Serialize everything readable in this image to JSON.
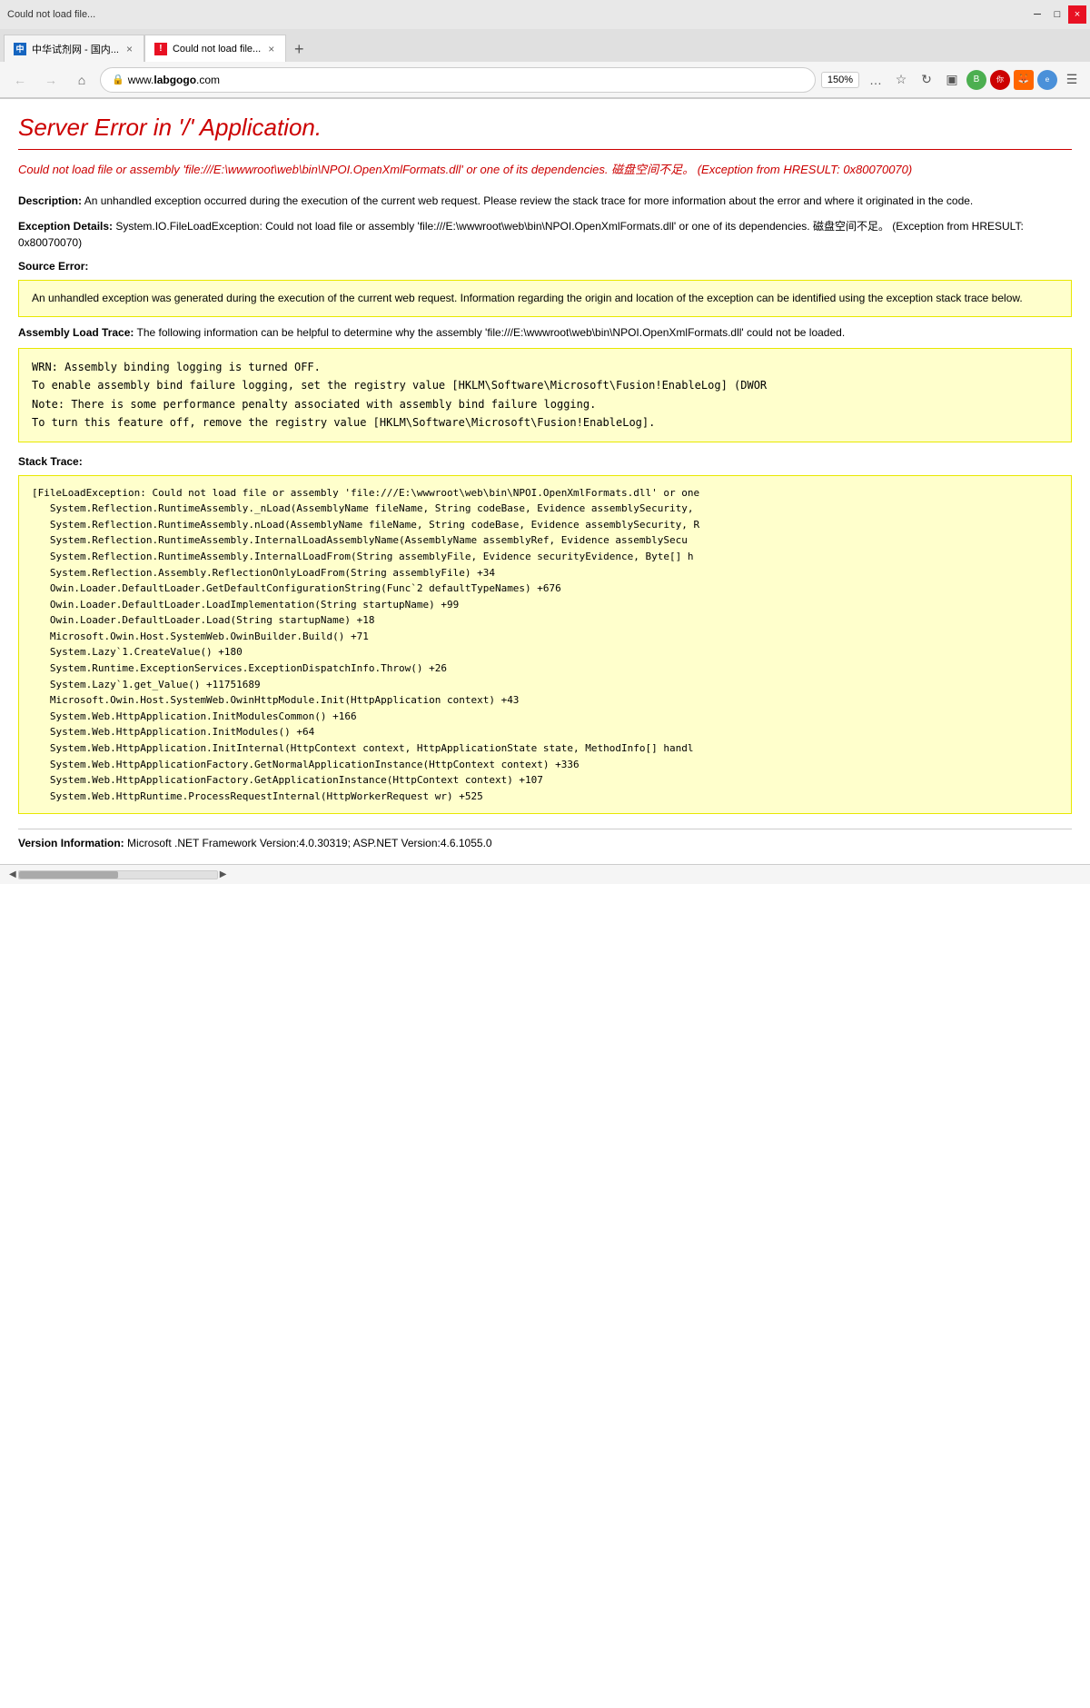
{
  "browser": {
    "tabs": [
      {
        "id": "tab1",
        "favicon_text": "中",
        "label": "中华试剂网 - 国内...",
        "active": false,
        "close_label": "×"
      },
      {
        "id": "tab2",
        "favicon_text": "!",
        "label": "Could not load file...",
        "active": true,
        "close_label": "×"
      }
    ],
    "new_tab_label": "+",
    "nav": {
      "back_label": "←",
      "forward_label": "→",
      "home_label": "⌂",
      "refresh_label": "↻"
    },
    "address": {
      "lock_icon": "🔒",
      "url_prefix": "www.",
      "url_domain": "labgogo",
      "url_suffix": ".com"
    },
    "zoom": "150%",
    "toolbar_icons": [
      "…",
      "☆",
      "↻",
      "⬛",
      "☰"
    ],
    "title_bar": {
      "minimize_label": "─",
      "maximize_label": "□",
      "close_label": "×"
    },
    "status_bar_text": ""
  },
  "page": {
    "server_error_title": "Server Error in '/' Application.",
    "error_message": "Could not load file or assembly 'file:///E:\\wwwroot\\web\\bin\\NPOI.OpenXmlFormats.dll' or one of its dependencies. 磁盘空间不足。 (Exception from HRESULT: 0x80070070)",
    "description_label": "Description:",
    "description_text": "An unhandled exception occurred during the execution of the current web request. Please review the stack trace for more information about the error and where it originated in the code.",
    "exception_details_label": "Exception Details:",
    "exception_details_text": "System.IO.FileLoadException: Could not load file or assembly 'file:///E:\\wwwroot\\web\\bin\\NPOI.OpenXmlFormats.dll' or one of its dependencies. 磁盘空间不足。 (Exception from HRESULT: 0x80070070)",
    "source_error_label": "Source Error:",
    "source_error_text": "An unhandled exception was generated during the execution of the current web request. Information regarding the origin and location of the exception can be identified using the exception stack trace below.",
    "assembly_load_trace_label": "Assembly Load Trace:",
    "assembly_load_trace_text": "The following information can be helpful to determine why the assembly 'file:///E:\\wwwroot\\web\\bin\\NPOI.OpenXmlFormats.dll' could not be loaded.",
    "assembly_log_content": "WRN: Assembly binding logging is turned OFF.\nTo enable assembly bind failure logging, set the registry value [HKLM\\Software\\Microsoft\\Fusion!EnableLog] (DWOR\nNote: There is some performance penalty associated with assembly bind failure logging.\nTo turn this feature off, remove the registry value [HKLM\\Software\\Microsoft\\Fusion!EnableLog].",
    "stack_trace_label": "Stack Trace:",
    "stack_trace_content": "[FileLoadException: Could not load file or assembly 'file:///E:\\wwwroot\\web\\bin\\NPOI.OpenXmlFormats.dll' or one\n   System.Reflection.RuntimeAssembly._nLoad(AssemblyName fileName, String codeBase, Evidence assemblySecurity,\n   System.Reflection.RuntimeAssembly.nLoad(AssemblyName fileName, String codeBase, Evidence assemblySecurity, R\n   System.Reflection.RuntimeAssembly.InternalLoadAssemblyName(AssemblyName assemblyRef, Evidence assemblySecu\n   System.Reflection.RuntimeAssembly.InternalLoadFrom(String assemblyFile, Evidence securityEvidence, Byte[] h\n   System.Reflection.Assembly.ReflectionOnlyLoadFrom(String assemblyFile) +34\n   Owin.Loader.DefaultLoader.GetDefaultConfigurationString(Func`2 defaultTypeNames) +676\n   Owin.Loader.DefaultLoader.LoadImplementation(String startupName) +99\n   Owin.Loader.DefaultLoader.Load(String startupName) +18\n   Microsoft.Owin.Host.SystemWeb.OwinBuilder.Build() +71\n   System.Lazy`1.CreateValue() +180\n   System.Runtime.ExceptionServices.ExceptionDispatchInfo.Throw() +26\n   System.Lazy`1.get_Value() +11751689\n   Microsoft.Owin.Host.SystemWeb.OwinHttpModule.Init(HttpApplication context) +43\n   System.Web.HttpApplication.InitModulesCommon() +166\n   System.Web.HttpApplication.InitModules() +64\n   System.Web.HttpApplication.InitInternal(HttpContext context, HttpApplicationState state, MethodInfo[] handl\n   System.Web.HttpApplicationFactory.GetNormalApplicationInstance(HttpContext context) +336\n   System.Web.HttpApplicationFactory.GetApplicationInstance(HttpContext context) +107\n   System.Web.HttpRuntime.ProcessRequestInternal(HttpWorkerRequest wr) +525",
    "version_info_label": "Version Information:",
    "version_info_text": "Microsoft .NET Framework Version:4.0.30319; ASP.NET Version:4.6.1055.0"
  }
}
